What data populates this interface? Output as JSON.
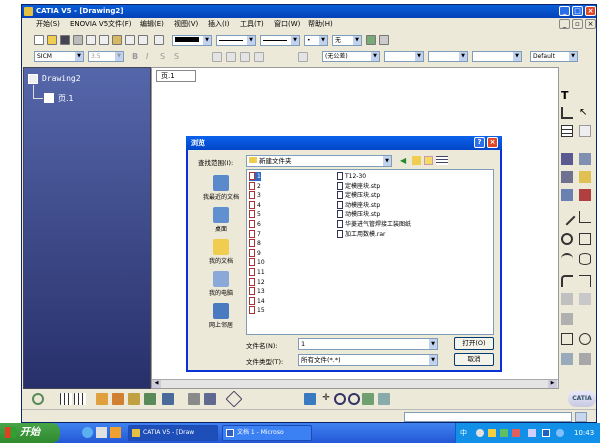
{
  "app": {
    "title": "CATIA V5 - [Drawing2]",
    "menus": [
      "开始(S)",
      "ENOVIA V5",
      "文件(F)",
      "编辑(E)",
      "视图(V)",
      "插入(I)",
      "工具(T)",
      "窗口(W)",
      "帮助(H)"
    ]
  },
  "toolbar": {
    "font_name": "SICM",
    "font_size": "3.5",
    "style_combo": "(无公差)",
    "layer_combo": "Default",
    "line_none": "无"
  },
  "tree": {
    "root": "Drawing2",
    "child": "页.1"
  },
  "canvas": {
    "sheet_tab": "页.1"
  },
  "dialog": {
    "title": "浏览",
    "look_in_label": "查找范围(I):",
    "look_in_value": "新建文件夹",
    "places": [
      "我最近的文档",
      "桌面",
      "我的文档",
      "我的电脑",
      "网上邻居"
    ],
    "files_col1": [
      "1",
      "2",
      "3",
      "4",
      "5",
      "6",
      "7",
      "8",
      "9",
      "10",
      "11",
      "12",
      "13",
      "14",
      "15"
    ],
    "files_col2": [
      "T12-30",
      "定模座块.stp",
      "定模压块.stp",
      "动模座块.stp",
      "动模压块.stp",
      "华菱进气管焊接工装图纸",
      "加工用数模.rar"
    ],
    "filename_label": "文件名(N):",
    "filename_value": "1",
    "filetype_label": "文件类型(T):",
    "filetype_value": "所有文件(*.*)",
    "open_button": "打开(O)",
    "cancel_button": "取消"
  },
  "taskbar": {
    "start": "开始",
    "tasks": [
      "CATIA V5 - [Draw",
      "文档 1 - Microso"
    ],
    "ime": "中",
    "clock": "10:43"
  },
  "logo": "CATIA",
  "colors": {
    "title_blue": "#0a5fd8",
    "tree_bg": "#3b4488",
    "start_green": "#3a9a3a",
    "xp_blue": "#2457d6"
  }
}
